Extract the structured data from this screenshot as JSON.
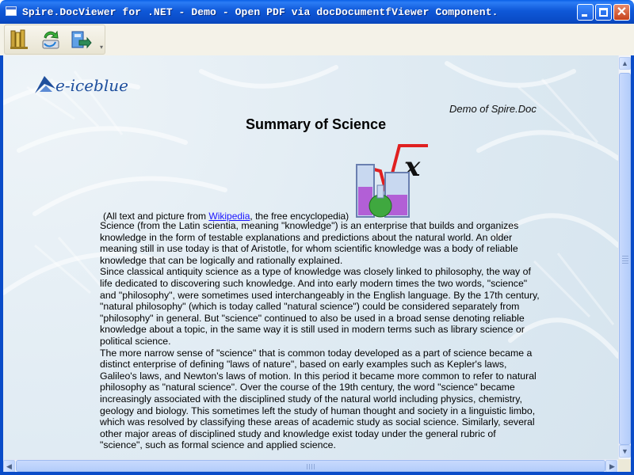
{
  "window": {
    "title": "Spire.DocViewer for .NET - Demo - Open PDF via docDocumentfViewer Component.",
    "icon": "app-window-icon",
    "controls": [
      "minimize-icon",
      "maximize-icon",
      "close-icon"
    ]
  },
  "toolbar": {
    "tools": [
      {
        "name": "open-document-button",
        "icon": "open-folder-icon"
      },
      {
        "name": "refresh-document-button",
        "icon": "sync-arrows-icon"
      },
      {
        "name": "export-document-button",
        "icon": "export-icon"
      }
    ]
  },
  "document": {
    "logo_text": "e-iceblue",
    "demo_of": "Demo of Spire.Doc",
    "title": "Summary of Science",
    "attribution_prefix": "(All text and picture from ",
    "attribution_link": "Wikipedia",
    "attribution_suffix": ", the free encyclopedia)",
    "paragraphs": [
      "Science (from the Latin scientia, meaning \"knowledge\") is an enterprise that builds and organizes knowledge in the form of testable explanations and predictions about the natural world. An older meaning still in use today is that of Aristotle, for whom scientific knowledge was a body of reliable knowledge that can be logically and rationally explained.",
      "Since classical antiquity science as a type of knowledge was closely linked to philosophy, the way of life dedicated to discovering such knowledge. And into early modern times the two words, \"science\" and \"philosophy\", were sometimes used interchangeably in the English language. By the 17th century, \"natural philosophy\" (which is today called \"natural science\") could be considered separately from \"philosophy\" in general. But \"science\" continued to also be used in a broad sense denoting reliable knowledge about a topic, in the same way it is still used in modern terms such as library science or political science.",
      "The more narrow sense of \"science\" that is common today developed as a part of science became a distinct enterprise of defining \"laws of nature\", based on early examples such as Kepler's laws, Galileo's laws, and Newton's laws of motion. In this period it became more common to refer to natural philosophy as \"natural science\". Over the course of the 19th century, the word \"science\" became increasingly associated with the disciplined study of the natural world including physics, chemistry, geology and biology. This sometimes left the study of human thought and society in a linguistic limbo, which was resolved by classifying these areas of academic study as social science. Similarly, several other major areas of disciplined study and knowledge exist today under the general rubric of \"science\", such as formal science and applied science."
    ]
  },
  "colors": {
    "titlebar": "#0a4cc8",
    "link": "#1a14ff",
    "logo": "#1f4f9d"
  }
}
